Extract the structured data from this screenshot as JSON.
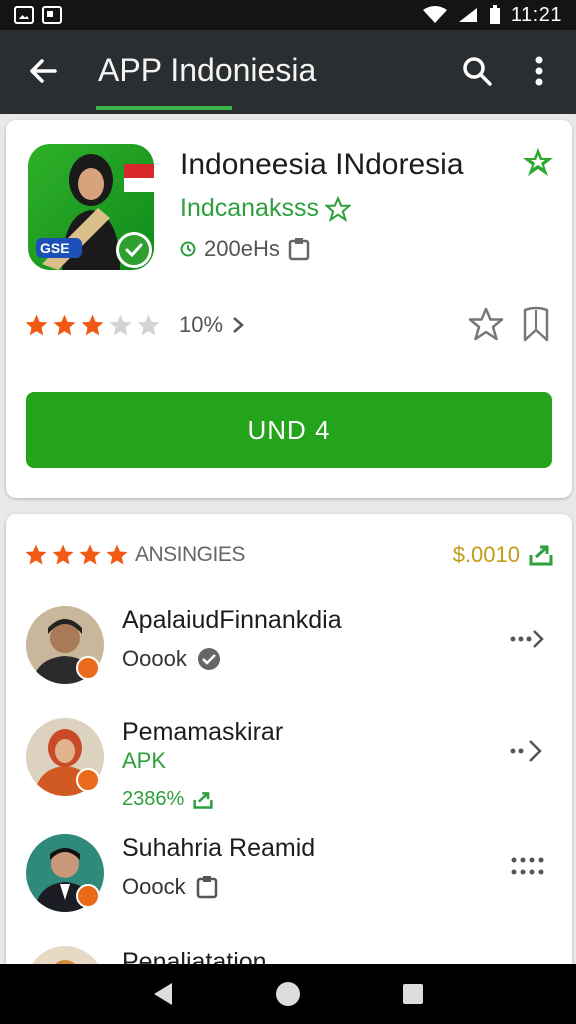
{
  "status_bar": {
    "time": "11:21",
    "icons": [
      "image-notification-icon",
      "box-notification-icon",
      "wifi-icon",
      "signal-icon",
      "battery-icon"
    ]
  },
  "app_bar": {
    "title": "APP Indoniesia",
    "icons": [
      "back-arrow-icon",
      "search-icon",
      "more-vert-icon"
    ],
    "accent": "#39b54a"
  },
  "app": {
    "name": "Indoneesia INdoresia",
    "developer": "Indcanaksss",
    "size": "200eHs",
    "icon_text": "GSE",
    "rating_stars": 3,
    "rating_max": 5,
    "rating_text": "10%",
    "install_label": "UND 4",
    "install_color": "#23a41b"
  },
  "list": {
    "header_label": "ANSINGIES",
    "header_stars": 4,
    "price": "$.0010",
    "items": [
      {
        "title": "ApalaiudFinnankdia",
        "subtitle": "Ooook",
        "action": "more-arrow-icon"
      },
      {
        "title": "Pemamaskirar",
        "subtitle": "APK",
        "extra": "2386%",
        "action": "more-arrow-icon"
      },
      {
        "title": "Suhahria Reamid",
        "subtitle": "Ooock",
        "action": "dots-grid-icon"
      },
      {
        "title": "Penaliatation"
      }
    ]
  },
  "nav_bar": {
    "icons": [
      "nav-back-icon",
      "nav-home-icon",
      "nav-recents-icon"
    ]
  }
}
